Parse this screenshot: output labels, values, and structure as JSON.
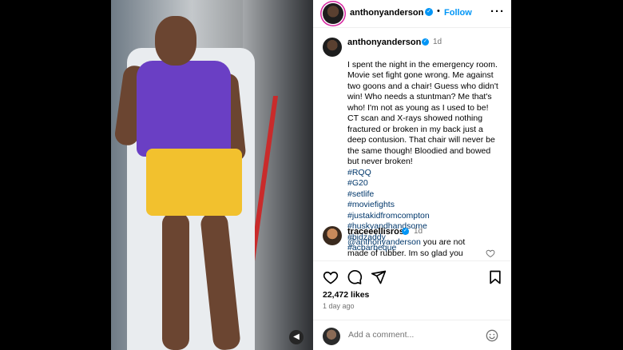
{
  "header": {
    "username": "anthonyanderson",
    "verified_mark": "✓",
    "separator": "•",
    "follow_label": "Follow",
    "more_label": "···"
  },
  "caption": {
    "username": "anthonyanderson",
    "verified_mark": "✓",
    "time": "1d",
    "text_plain": "I spent the night in the emergency room. Movie set fight gone wrong. Me against two goons and a chair! Guess who didn't win! Who needs a stuntman? Me that's who! I'm not as young as I used to be! CT scan and X-rays showed nothing fractured or broken in my back just a deep contusion. That chair will never be the same though! Bloodied and bowed but never broken!",
    "hashtags": [
      "#RQQ",
      "#G20",
      "#setlife",
      "#moviefights",
      "#justakidfromcompton",
      "#huskyandhandsome",
      "#bidzaddy",
      "#acbarbeque"
    ]
  },
  "comment": {
    "username": "traceeellisross",
    "verified_mark": "✓",
    "time": "1d",
    "mention": "@anthonyanderson",
    "text": " you are not made of rubber. Im so glad you",
    "like_icon": "heart-outline-icon"
  },
  "actions": {
    "icons": [
      "heart-outline-icon",
      "comment-icon",
      "share-icon",
      "bookmark-icon"
    ],
    "likes": "22,472 likes",
    "time_ago": "1 day ago"
  },
  "add_comment": {
    "placeholder": "Add a comment...",
    "emoji_icon": "emoji-icon"
  },
  "media": {
    "mute_icon": "speaker-muted-icon",
    "mute_glyph": "◀"
  },
  "colors": {
    "accent": "#0095f6",
    "hashtag": "#00376b",
    "muted_text": "#737373"
  }
}
